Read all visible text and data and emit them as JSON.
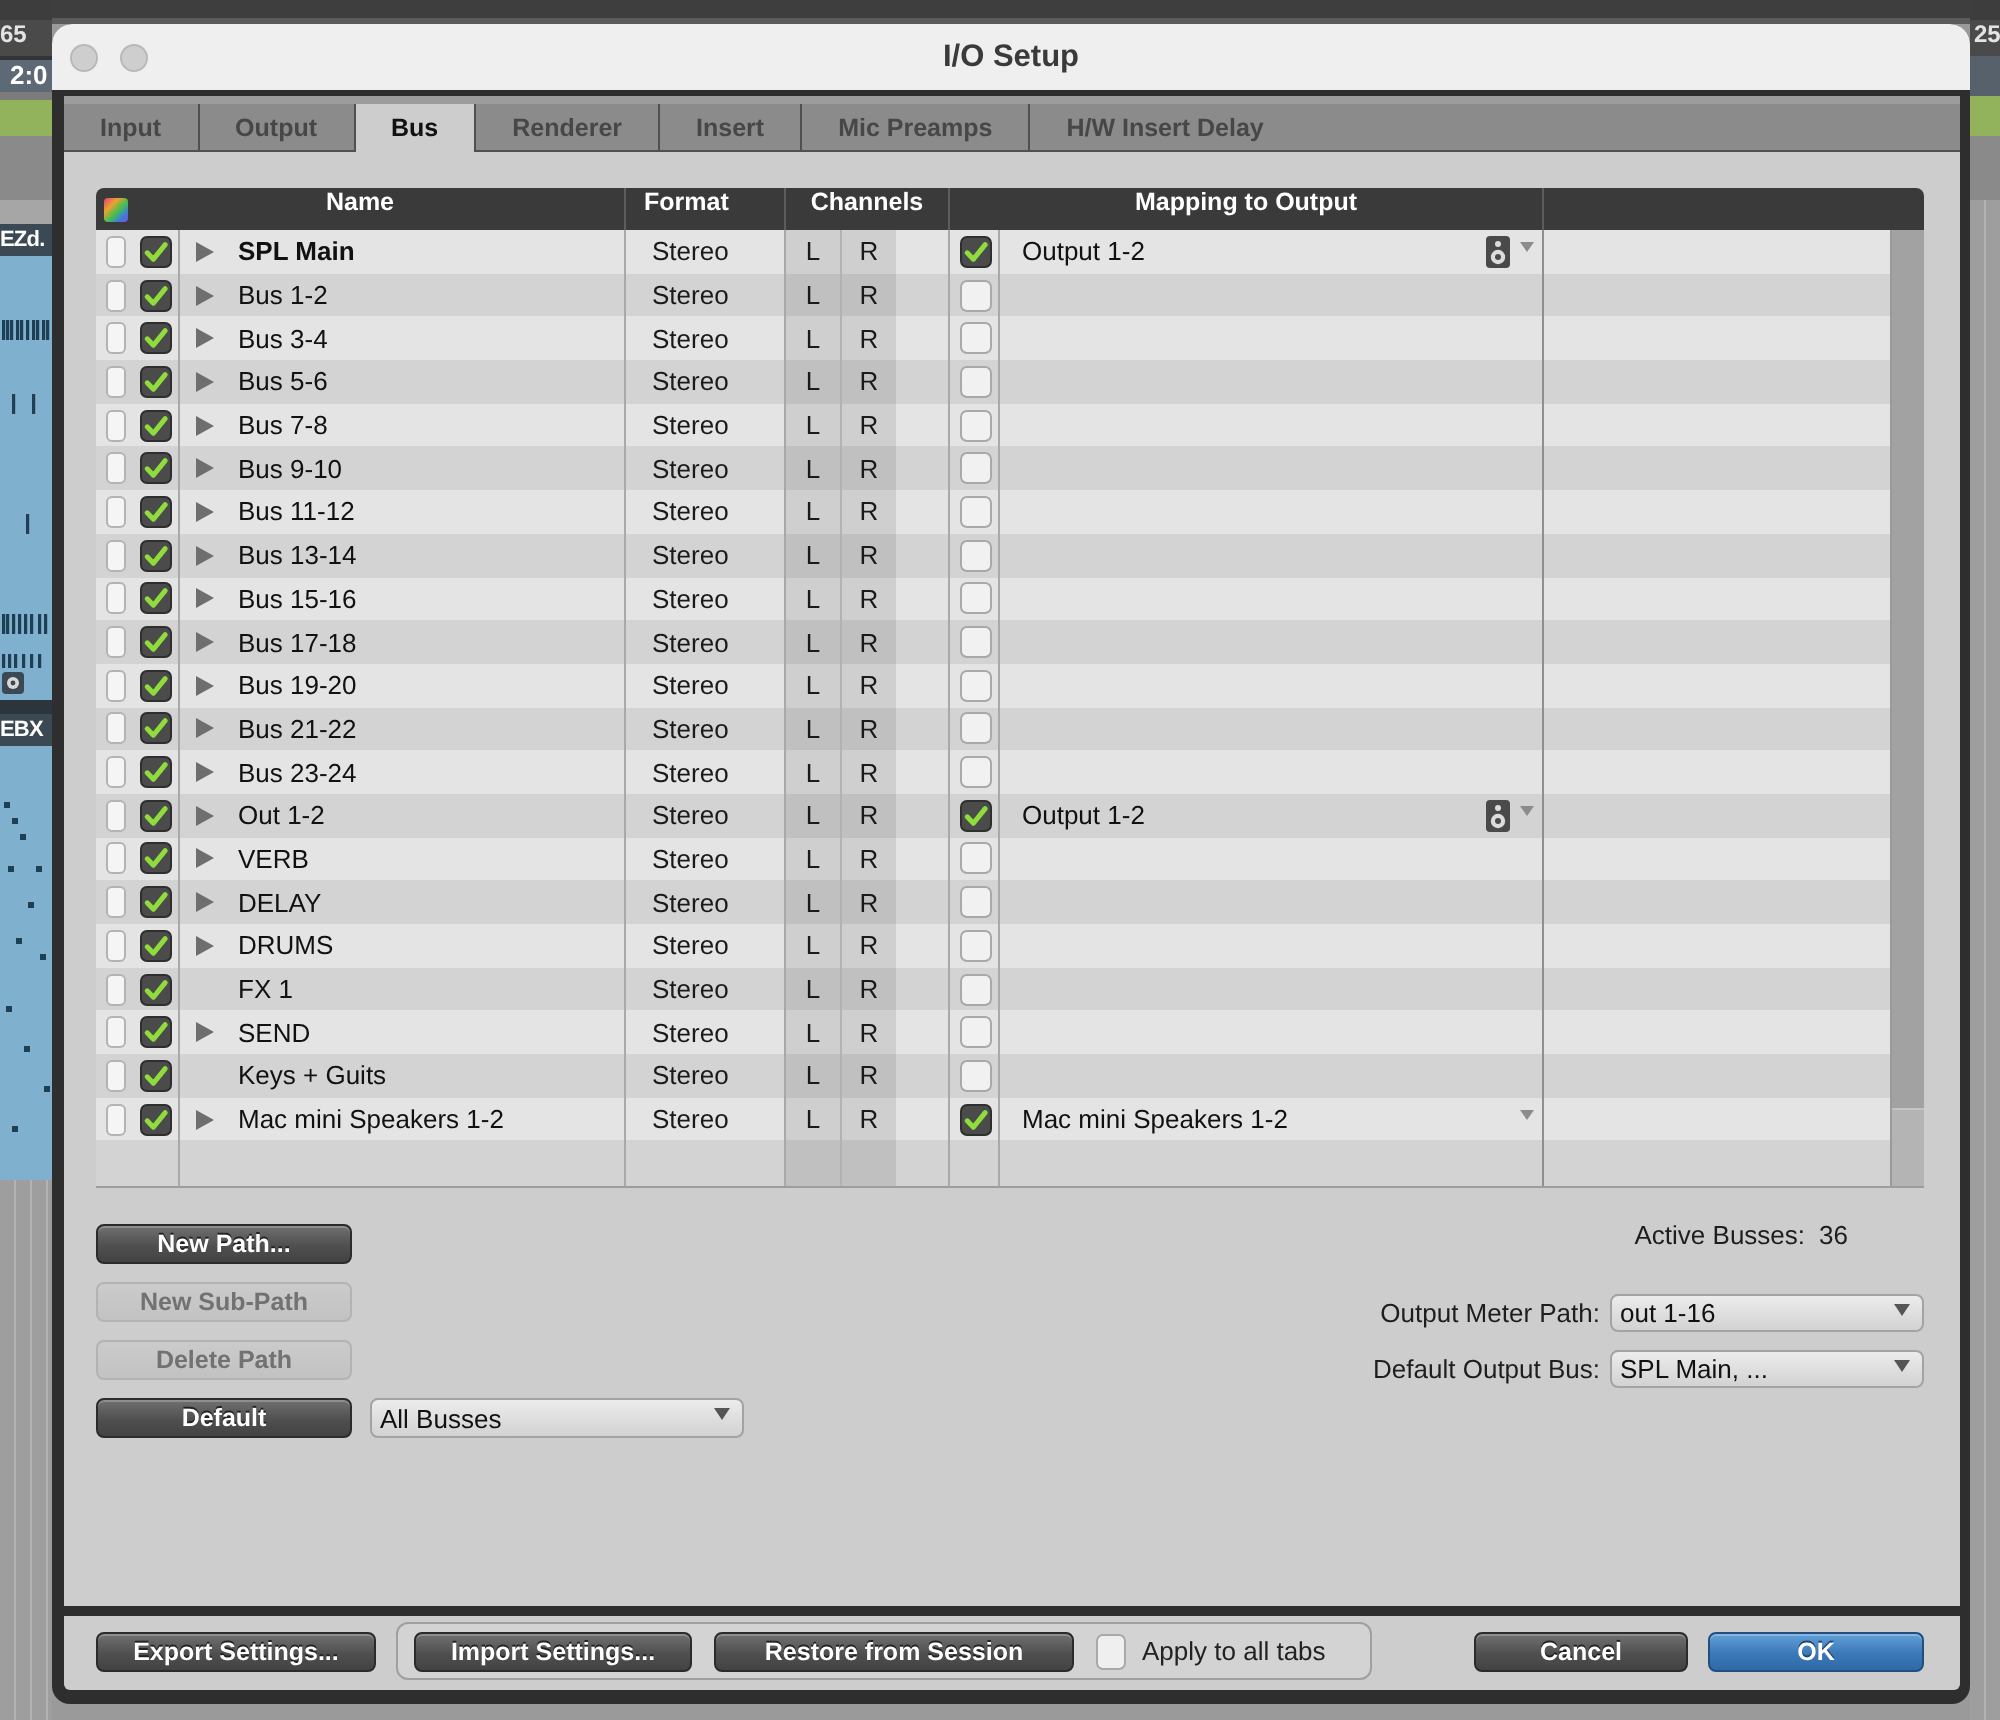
{
  "daw_background": {
    "left": {
      "ruler_label": "65",
      "counter": "2:0",
      "clips": [
        "EZd.",
        "EBX"
      ]
    },
    "right": {
      "ruler_label": "25"
    }
  },
  "window": {
    "title": "I/O Setup"
  },
  "tabs": [
    {
      "label": "Input",
      "selected": false
    },
    {
      "label": "Output",
      "selected": false
    },
    {
      "label": "Bus",
      "selected": true
    },
    {
      "label": "Renderer",
      "selected": false
    },
    {
      "label": "Insert",
      "selected": false
    },
    {
      "label": "Mic Preamps",
      "selected": false
    },
    {
      "label": "H/W Insert Delay",
      "selected": false
    }
  ],
  "table": {
    "columns": [
      {
        "label": "Name"
      },
      {
        "label": "Format"
      },
      {
        "label": "Channels"
      },
      {
        "label": "Mapping to Output"
      }
    ],
    "rows": [
      {
        "name": "SPL Main",
        "emphasized": true,
        "expandable": true,
        "active": true,
        "format": "Stereo",
        "channels": [
          "L",
          "R"
        ],
        "mapped": true,
        "mapping": "Output 1-2",
        "speaker": true
      },
      {
        "name": "Bus 1-2",
        "emphasized": false,
        "expandable": true,
        "active": true,
        "format": "Stereo",
        "channels": [
          "L",
          "R"
        ],
        "mapped": false,
        "speaker": false
      },
      {
        "name": "Bus 3-4",
        "emphasized": false,
        "expandable": true,
        "active": true,
        "format": "Stereo",
        "channels": [
          "L",
          "R"
        ],
        "mapped": false,
        "speaker": false
      },
      {
        "name": "Bus 5-6",
        "emphasized": false,
        "expandable": true,
        "active": true,
        "format": "Stereo",
        "channels": [
          "L",
          "R"
        ],
        "mapped": false,
        "speaker": false
      },
      {
        "name": "Bus 7-8",
        "emphasized": false,
        "expandable": true,
        "active": true,
        "format": "Stereo",
        "channels": [
          "L",
          "R"
        ],
        "mapped": false,
        "speaker": false
      },
      {
        "name": "Bus 9-10",
        "emphasized": false,
        "expandable": true,
        "active": true,
        "format": "Stereo",
        "channels": [
          "L",
          "R"
        ],
        "mapped": false,
        "speaker": false
      },
      {
        "name": "Bus 11-12",
        "emphasized": false,
        "expandable": true,
        "active": true,
        "format": "Stereo",
        "channels": [
          "L",
          "R"
        ],
        "mapped": false,
        "speaker": false
      },
      {
        "name": "Bus 13-14",
        "emphasized": false,
        "expandable": true,
        "active": true,
        "format": "Stereo",
        "channels": [
          "L",
          "R"
        ],
        "mapped": false,
        "speaker": false
      },
      {
        "name": "Bus 15-16",
        "emphasized": false,
        "expandable": true,
        "active": true,
        "format": "Stereo",
        "channels": [
          "L",
          "R"
        ],
        "mapped": false,
        "speaker": false
      },
      {
        "name": "Bus 17-18",
        "emphasized": false,
        "expandable": true,
        "active": true,
        "format": "Stereo",
        "channels": [
          "L",
          "R"
        ],
        "mapped": false,
        "speaker": false
      },
      {
        "name": "Bus 19-20",
        "emphasized": false,
        "expandable": true,
        "active": true,
        "format": "Stereo",
        "channels": [
          "L",
          "R"
        ],
        "mapped": false,
        "speaker": false
      },
      {
        "name": "Bus 21-22",
        "emphasized": false,
        "expandable": true,
        "active": true,
        "format": "Stereo",
        "channels": [
          "L",
          "R"
        ],
        "mapped": false,
        "speaker": false
      },
      {
        "name": "Bus 23-24",
        "emphasized": false,
        "expandable": true,
        "active": true,
        "format": "Stereo",
        "channels": [
          "L",
          "R"
        ],
        "mapped": false,
        "speaker": false
      },
      {
        "name": "Out 1-2",
        "emphasized": false,
        "expandable": true,
        "active": true,
        "format": "Stereo",
        "channels": [
          "L",
          "R"
        ],
        "mapped": true,
        "mapping": "Output 1-2",
        "speaker": true
      },
      {
        "name": "VERB",
        "emphasized": false,
        "expandable": true,
        "active": true,
        "format": "Stereo",
        "channels": [
          "L",
          "R"
        ],
        "mapped": false,
        "speaker": false
      },
      {
        "name": "DELAY",
        "emphasized": false,
        "expandable": true,
        "active": true,
        "format": "Stereo",
        "channels": [
          "L",
          "R"
        ],
        "mapped": false,
        "speaker": false
      },
      {
        "name": "DRUMS",
        "emphasized": false,
        "expandable": true,
        "active": true,
        "format": "Stereo",
        "channels": [
          "L",
          "R"
        ],
        "mapped": false,
        "speaker": false
      },
      {
        "name": "FX 1",
        "emphasized": false,
        "expandable": false,
        "active": true,
        "format": "Stereo",
        "channels": [
          "L",
          "R"
        ],
        "mapped": false,
        "speaker": false
      },
      {
        "name": "SEND",
        "emphasized": false,
        "expandable": true,
        "active": true,
        "format": "Stereo",
        "channels": [
          "L",
          "R"
        ],
        "mapped": false,
        "speaker": false
      },
      {
        "name": "Keys + Guits",
        "emphasized": false,
        "expandable": false,
        "active": true,
        "format": "Stereo",
        "channels": [
          "L",
          "R"
        ],
        "mapped": false,
        "speaker": false
      },
      {
        "name": "Mac mini Speakers 1-2",
        "emphasized": false,
        "expandable": true,
        "active": true,
        "format": "Stereo",
        "channels": [
          "L",
          "R"
        ],
        "mapped": true,
        "mapping": "Mac mini Speakers 1-2",
        "speaker": false
      }
    ]
  },
  "path_buttons": [
    {
      "label": "New Path...",
      "disabled": false
    },
    {
      "label": "New Sub-Path",
      "disabled": true
    },
    {
      "label": "Delete Path",
      "disabled": true
    }
  ],
  "default_row": {
    "button": "Default",
    "filter": "All Busses"
  },
  "active_busses": {
    "label": "Active Busses:",
    "value": "36"
  },
  "settings": [
    {
      "label": "Output Meter Path:",
      "value": "out 1-16"
    },
    {
      "label": "Default Output Bus:",
      "value": "SPL Main, ..."
    }
  ],
  "footer": {
    "export": "Export Settings...",
    "import": "Import Settings...",
    "restore": "Restore from Session",
    "apply_to_all_tabs": {
      "label": "Apply to all tabs",
      "checked": false
    },
    "actions": [
      {
        "label": "Cancel",
        "primary": false
      },
      {
        "label": "OK",
        "primary": true
      }
    ]
  }
}
